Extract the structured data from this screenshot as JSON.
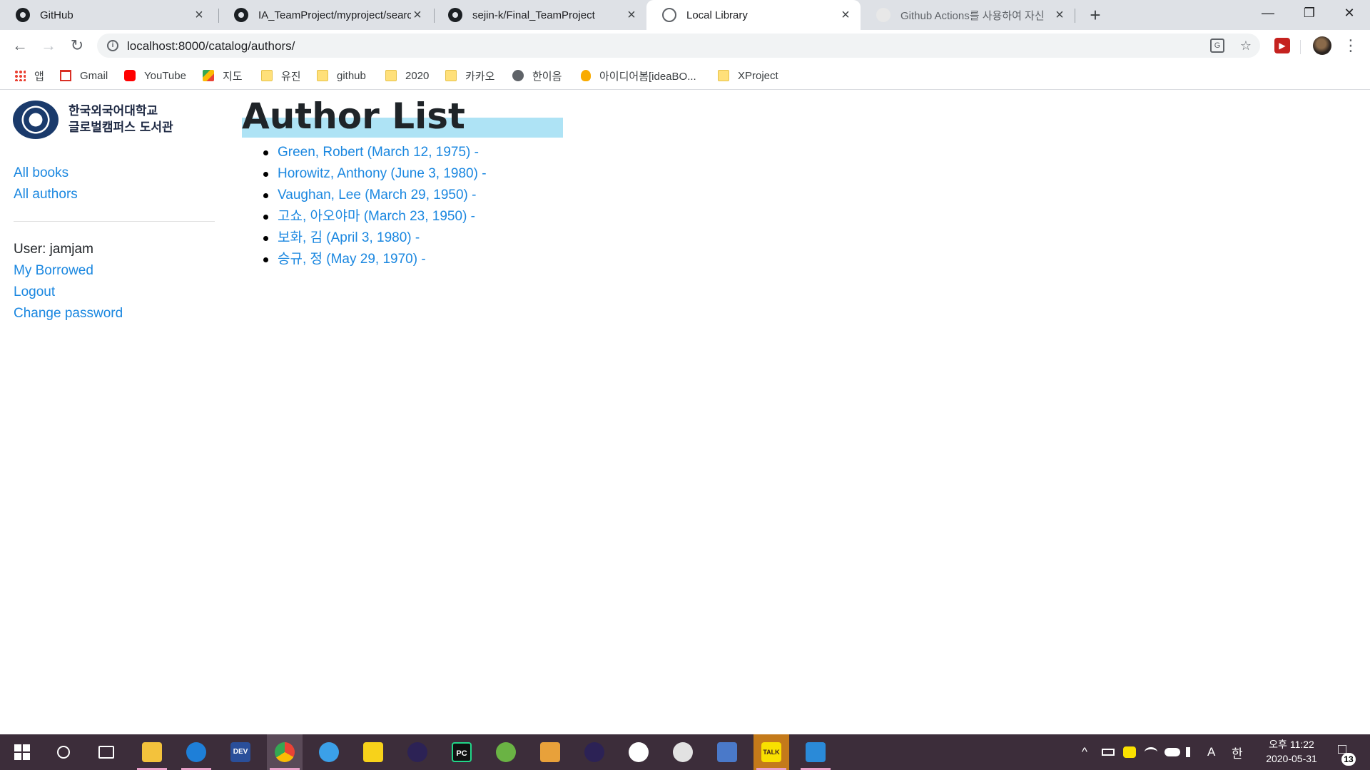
{
  "browser": {
    "tabs": [
      {
        "title": "GitHub",
        "icon": "github-icon"
      },
      {
        "title": "IA_TeamProject/myproject/searc",
        "icon": "github-icon"
      },
      {
        "title": "sejin-k/Final_TeamProject",
        "icon": "github-icon"
      },
      {
        "title": "Local Library",
        "icon": "globe-icon",
        "active": true
      },
      {
        "title": "Github Actions를 사용하여 자신",
        "icon": "page-icon"
      }
    ],
    "tab_close": "×",
    "new_tab": "+",
    "window_controls": {
      "minimize": "—",
      "maximize": "❐",
      "close": "✕"
    },
    "nav": {
      "back": "←",
      "forward": "→",
      "reload": "↻"
    },
    "info_glyph": "i",
    "url": "localhost:8000/catalog/authors/",
    "translate_glyph": "G",
    "star_glyph": "☆",
    "extension_glyph": "▶",
    "menu_glyph": "⋮",
    "bookmarks": [
      {
        "label": "앱",
        "icon": "apps-icon"
      },
      {
        "label": "Gmail",
        "icon": "gmail-icon"
      },
      {
        "label": "YouTube",
        "icon": "youtube-icon"
      },
      {
        "label": "지도",
        "icon": "maps-icon"
      },
      {
        "label": "유진",
        "icon": "folder-icon"
      },
      {
        "label": "github",
        "icon": "folder-icon"
      },
      {
        "label": "2020",
        "icon": "folder-icon"
      },
      {
        "label": "카카오",
        "icon": "folder-icon"
      },
      {
        "label": "한이음",
        "icon": "globe-icon"
      },
      {
        "label": "아이디어봄[ideaBO...",
        "icon": "bulb-icon"
      },
      {
        "label": "XProject",
        "icon": "folder-icon"
      }
    ]
  },
  "sidebar": {
    "logo_line1": "한국외국어대학교",
    "logo_line2": "글로벌캠퍼스 도서관",
    "links": {
      "all_books": "All books",
      "all_authors": "All authors"
    },
    "user_label": "User: jamjam",
    "user_links": {
      "my_borrowed": "My Borrowed",
      "logout": "Logout",
      "change_password": "Change password"
    }
  },
  "main": {
    "title": "Author List",
    "authors": [
      "Green, Robert (March 12, 1975) -",
      "Horowitz, Anthony (June 3, 1980) -",
      "Vaughan, Lee (March 29, 1950) -",
      "고쇼, 아오야마 (March 23, 1950) -",
      "보화, 김 (April 3, 1980) -",
      "승규, 정 (May 29, 1970) -"
    ]
  },
  "taskbar": {
    "apps": [
      "start-icon",
      "search-icon",
      "task-view-icon",
      "file-explorer-icon",
      "edge-icon",
      "devcpp-icon",
      "chrome-icon",
      "ie-icon",
      "sticky-notes-icon",
      "eclipse-icon",
      "pycharm-icon",
      "android-studio-icon",
      "network-app-icon",
      "eclipse-icon",
      "github-desktop-icon",
      "paint-icon",
      "remote-desktop-icon",
      "kakaotalk-icon",
      "vscode-icon"
    ],
    "tray_chevron": "^",
    "ime_a": "A",
    "ime_han": "한",
    "clock_time": "오후 11:22",
    "clock_date": "2020-05-31",
    "notification_count": "13",
    "kakao_label": "TALK",
    "devcpp_label": "DEV",
    "pycharm_label": "PC"
  }
}
